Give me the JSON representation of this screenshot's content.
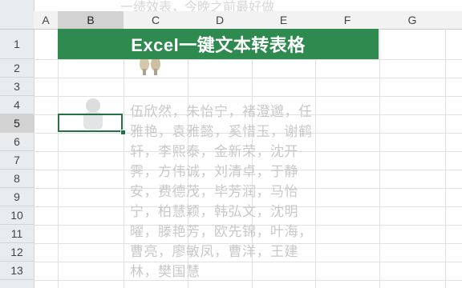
{
  "columns": [
    "A",
    "B",
    "C",
    "D",
    "E",
    "F",
    "G"
  ],
  "rows": [
    "1",
    "2",
    "3",
    "4",
    "5",
    "6",
    "7",
    "8",
    "9",
    "10",
    "11",
    "12",
    "13"
  ],
  "selected_column": "B",
  "selected_row": "5",
  "banner_text": "Excel一键文本转表格",
  "overlay_top_text": "一绩效表，今晚之前最好做",
  "name_text": "伍欣然，朱怡宁，褚澄邈，任雅艳，袁雅懿，奚惜玉，谢鹤轩，李熙泰，金新荣，沈开霁，方伟诚，刘清卓，于静安，费德茂，毕芳润，马怡宁，柏慧颖，韩弘文，沈明曜，滕艳芳，欧先锦，叶海，曹亮，廖敏凤，曹洋，王建林，樊国慧",
  "colors": {
    "banner": "#2e8a4e",
    "selection": "#217346",
    "header_selected": "#d2d2d2"
  }
}
